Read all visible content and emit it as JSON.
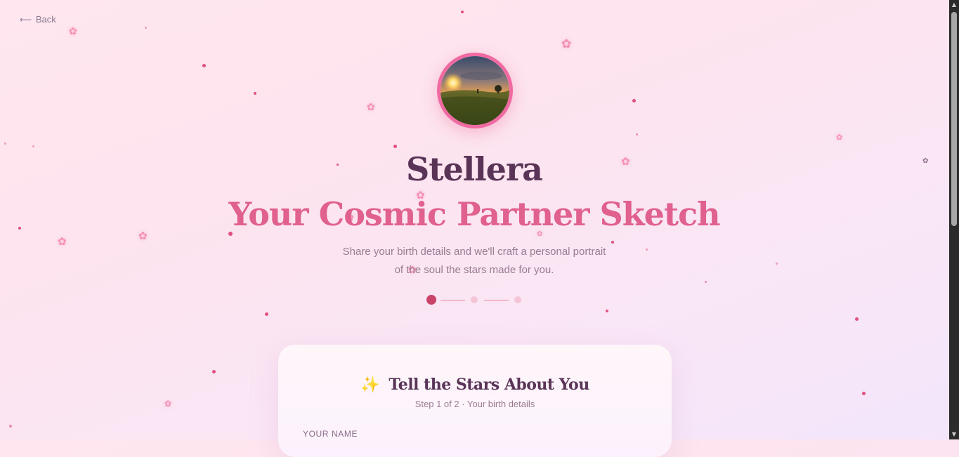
{
  "nav": {
    "back_label": "Back",
    "back_arrow": "⟵"
  },
  "brand": {
    "name": "Stellera"
  },
  "hero": {
    "title": "Your Cosmic Partner Sketch",
    "subtitle_line1": "Share your birth details and we'll craft a personal portrait",
    "subtitle_line2": "of the soul the stars made for you."
  },
  "progress": {
    "current_step": 1,
    "total_steps": 3
  },
  "card": {
    "icon": "sparkles-icon",
    "icon_glyph": "✨",
    "title": "Tell the Stars About You",
    "subtitle": "Step 1 of 2 · Your birth details",
    "field_label": "YOUR NAME"
  },
  "colors": {
    "brand_text": "#5a3457",
    "accent_pink": "#e0608e",
    "step_active": "#c94468",
    "step_inactive": "#f4c6d5"
  }
}
